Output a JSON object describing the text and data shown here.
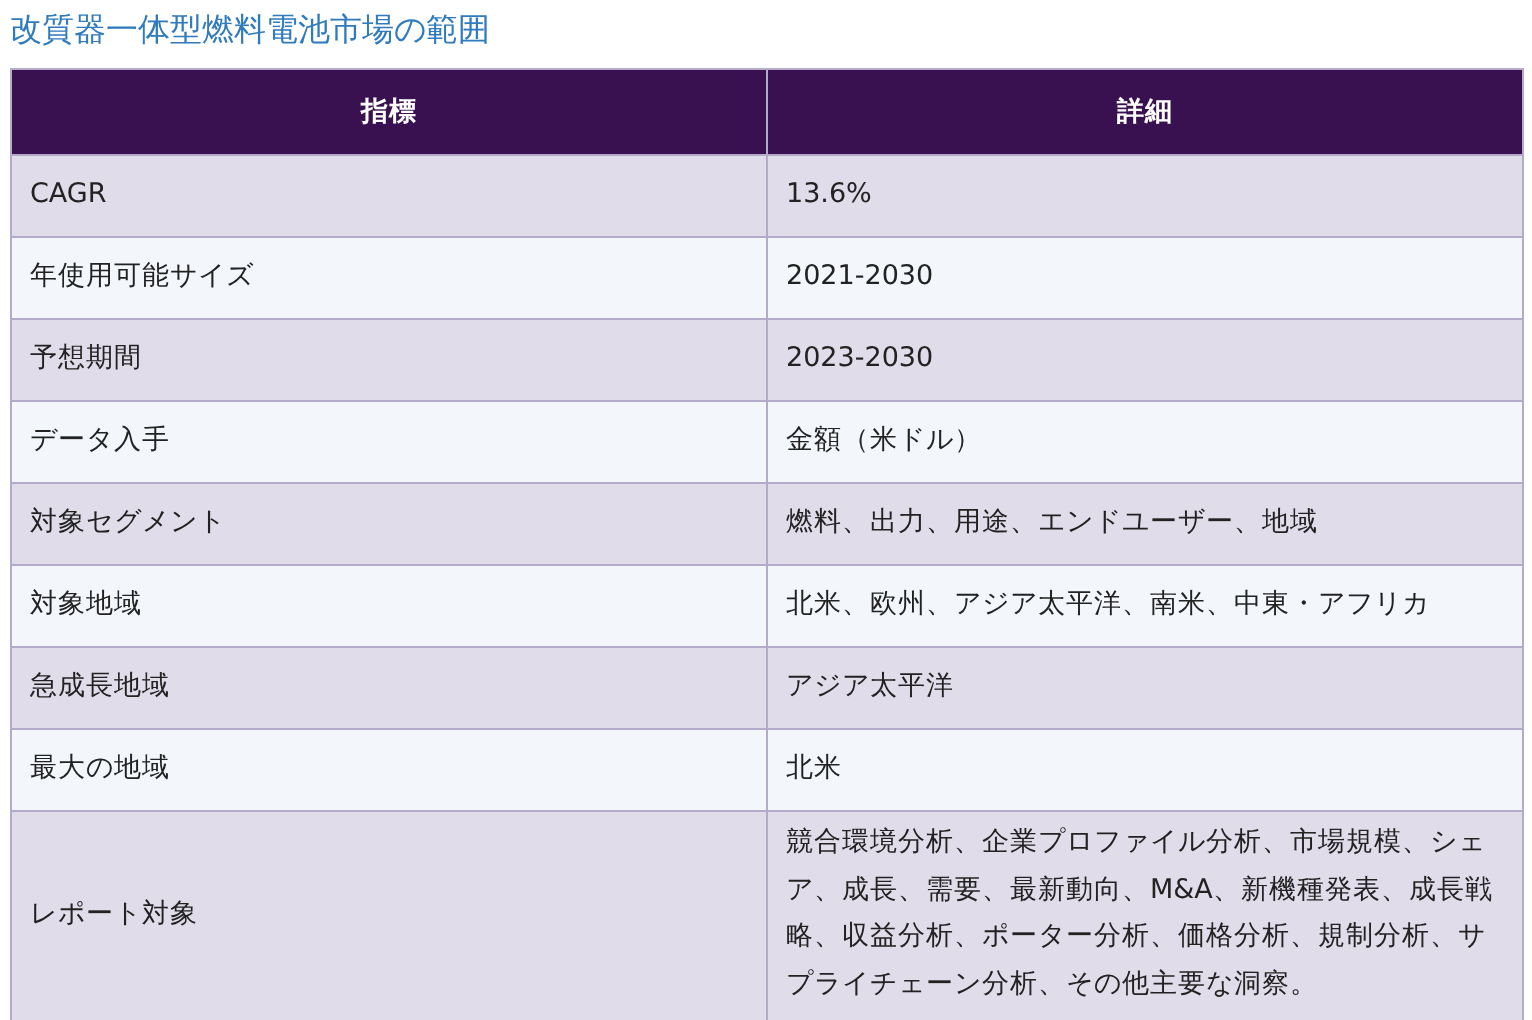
{
  "title": "改質器一体型燃料電池市場の範囲",
  "table": {
    "columns": [
      "指標",
      "詳細"
    ],
    "rows": [
      [
        "CAGR",
        "13.6%"
      ],
      [
        "年使用可能サイズ",
        "2021-2030"
      ],
      [
        "予想期間",
        "2023-2030"
      ],
      [
        "データ入手",
        "金額（米ドル）"
      ],
      [
        "対象セグメント",
        "燃料、出力、用途、エンドユーザー、地域"
      ],
      [
        "対象地域",
        "北米、欧州、アジア太平洋、南米、中東・アフリカ"
      ],
      [
        "急成長地域",
        "アジア太平洋"
      ],
      [
        "最大の地域",
        "北米"
      ],
      [
        "レポート対象",
        "競合環境分析、企業プロファイル分析、市場規模、シェア、成長、需要、最新動向、M&A、新機種発表、成長戦略、収益分析、ポーター分析、価格分析、規制分析、サプライチェーン分析、その他主要な洞察。"
      ]
    ]
  }
}
